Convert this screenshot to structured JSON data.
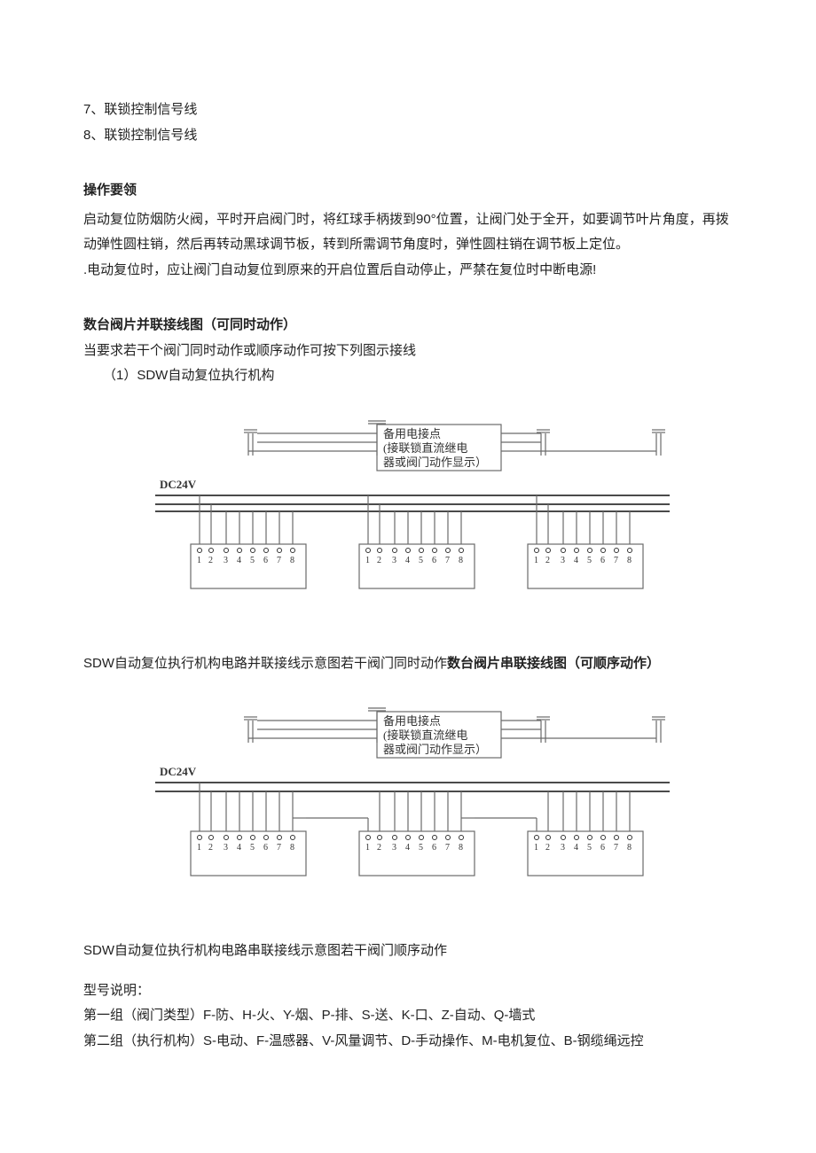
{
  "intro_lines": {
    "l7": "7、联锁控制信号线",
    "l8": "8、联锁控制信号线"
  },
  "op_title": "操作要领",
  "op_para1": "启动复位防烟防火阀，平时开启阀门时，将红球手柄拨到90°位置，让阀门处于全开，如要调节叶片角度，再拨动弹性圆柱销，然后再转动黑球调节板，转到所需调节角度时，弹性圆柱销在调节板上定位。",
  "op_para2": ".电动复位时，应让阀门自动复位到原来的开启位置后自动停止，严禁在复位时中断电源!",
  "parallel_title": "数台阀片并联接线图（可同时动作）",
  "parallel_intro": "当要求若干个阀门同时动作或顺序动作可按下列图示接线",
  "parallel_sub1": "（1）SDW自动复位执行机构",
  "diagram": {
    "spare_line1": "备用电接点",
    "spare_line2": "(接联锁直流继电",
    "spare_line3": "器或阀门动作显示）",
    "dc_label": "DC24V",
    "terminals": [
      "1",
      "2",
      "3",
      "4",
      "5",
      "6",
      "7",
      "8"
    ]
  },
  "parallel_caption_plain": "SDW自动复位执行机构电路并联接线示意图若干阀门同时动作",
  "series_title_inline": "数台阀片串联接线图（可顺序动作）",
  "series_caption": "SDW自动复位执行机构电路串联接线示意图若干阀门顺序动作",
  "model": {
    "heading": "型号说明：",
    "line1": "第一组（阀门类型）F-防、H-火、Y-烟、P-排、S-送、K-口、Z-自动、Q-墙式",
    "line2": "第二组（执行机构）S-电动、F-温感器、V-风量调节、D-手动操作、M-电机复位、B-钢缆绳远控"
  }
}
